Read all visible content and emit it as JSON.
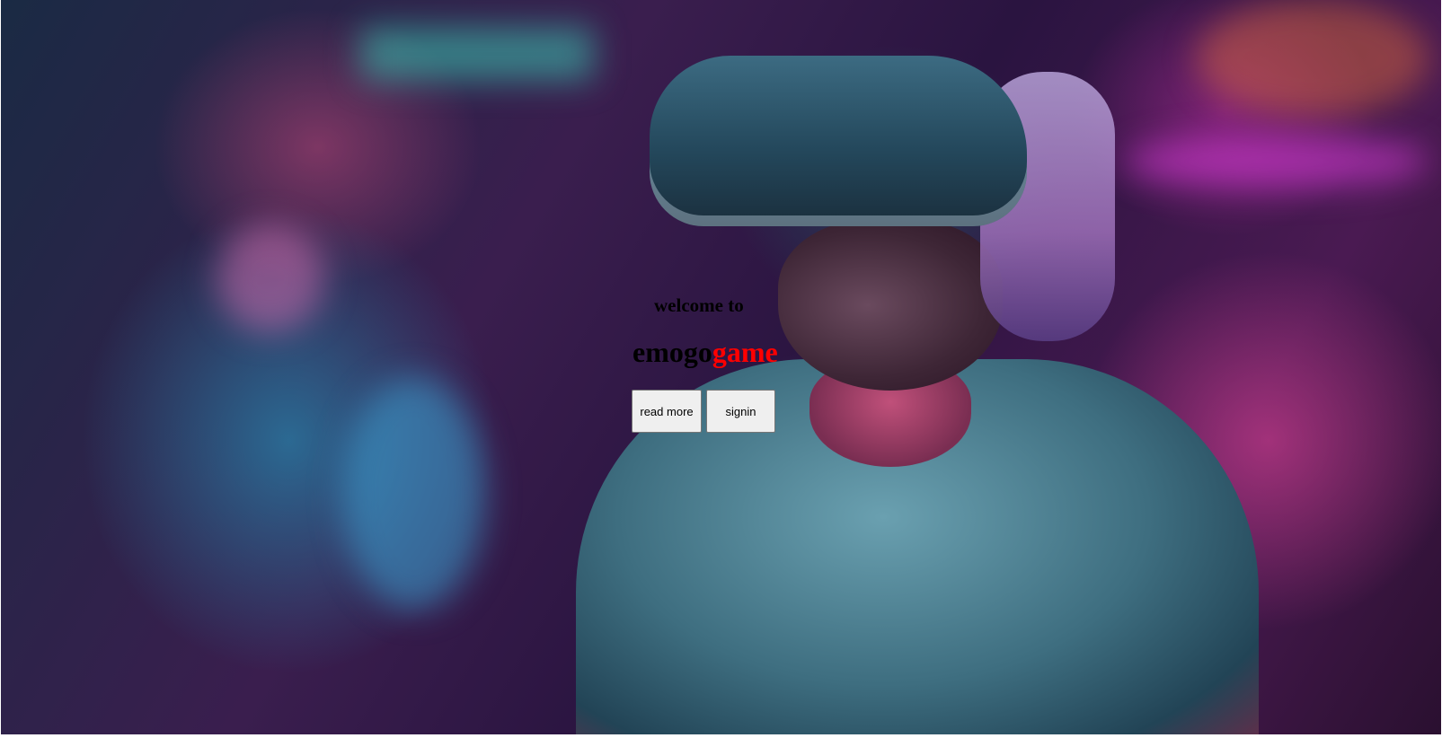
{
  "hero": {
    "welcome_text": "welcome to",
    "brand_prefix": "emogo",
    "brand_suffix": "game",
    "brand_accent_color": "#ff0000",
    "buttons": {
      "read_more_label": "read more",
      "signin_label": "signin"
    }
  }
}
